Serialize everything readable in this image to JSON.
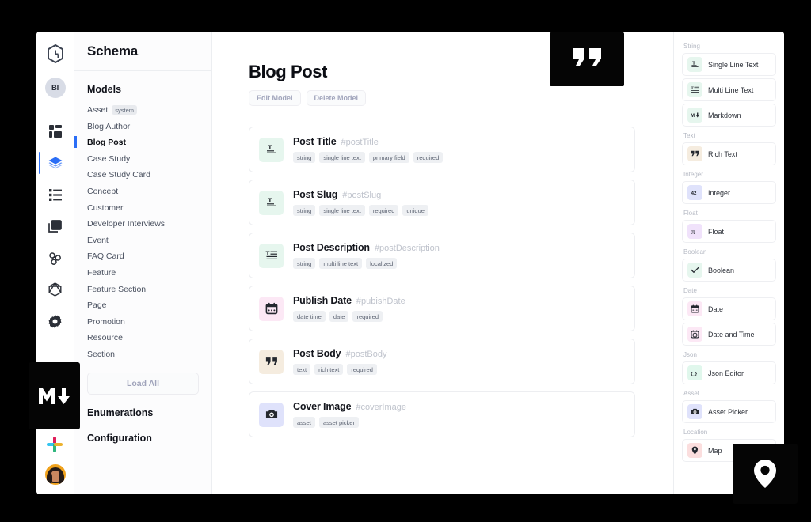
{
  "app": {
    "rail": {
      "logo_icon": "graphcms-logo-icon",
      "project_initials": "BI",
      "items": [
        {
          "icon": "dashboard-grid-icon",
          "name": "dashboard",
          "active": false
        },
        {
          "icon": "layers-schema-icon",
          "name": "schema",
          "active": true
        },
        {
          "icon": "content-list-icon",
          "name": "content",
          "active": false
        },
        {
          "icon": "assets-images-icon",
          "name": "assets",
          "active": false
        },
        {
          "icon": "webhooks-icon",
          "name": "webhooks",
          "active": false
        },
        {
          "icon": "graphql-playground-icon",
          "name": "api-playground",
          "active": false
        },
        {
          "icon": "gear-settings-icon",
          "name": "settings",
          "active": false
        }
      ],
      "bottom": [
        {
          "icon": "slack-icon",
          "name": "slack"
        },
        {
          "icon": "user-avatar",
          "name": "account"
        }
      ]
    },
    "sidebar": {
      "title": "Schema",
      "models_heading": "Models",
      "models": [
        {
          "label": "Asset",
          "badge": "system",
          "selected": false
        },
        {
          "label": "Blog Author",
          "badge": "",
          "selected": false
        },
        {
          "label": "Blog Post",
          "badge": "",
          "selected": true
        },
        {
          "label": "Case Study",
          "badge": "",
          "selected": false
        },
        {
          "label": "Case Study Card",
          "badge": "",
          "selected": false
        },
        {
          "label": "Concept",
          "badge": "",
          "selected": false
        },
        {
          "label": "Customer",
          "badge": "",
          "selected": false
        },
        {
          "label": "Developer Interviews",
          "badge": "",
          "selected": false
        },
        {
          "label": "Event",
          "badge": "",
          "selected": false
        },
        {
          "label": "FAQ Card",
          "badge": "",
          "selected": false
        },
        {
          "label": "Feature",
          "badge": "",
          "selected": false
        },
        {
          "label": "Feature Section",
          "badge": "",
          "selected": false
        },
        {
          "label": "Page",
          "badge": "",
          "selected": false
        },
        {
          "label": "Promotion",
          "badge": "",
          "selected": false
        },
        {
          "label": "Resource",
          "badge": "",
          "selected": false
        },
        {
          "label": "Section",
          "badge": "",
          "selected": false
        }
      ],
      "load_all_label": "Load All",
      "links": [
        {
          "label": "Enumerations"
        },
        {
          "label": "Configuration"
        }
      ]
    },
    "main": {
      "title": "Blog Post",
      "edit_model_label": "Edit Model",
      "delete_model_label": "Delete Model",
      "fields": [
        {
          "name": "Post Title",
          "api_id": "#postTitle",
          "icon": "single-line-text-icon",
          "icon_bg": "#e6f6ee",
          "chips": [
            "string",
            "single line text",
            "primary field",
            "required"
          ]
        },
        {
          "name": "Post Slug",
          "api_id": "#postSlug",
          "icon": "single-line-text-icon",
          "icon_bg": "#e6f6ee",
          "chips": [
            "string",
            "single line text",
            "required",
            "unique"
          ]
        },
        {
          "name": "Post Description",
          "api_id": "#postDescription",
          "icon": "multi-line-text-icon",
          "icon_bg": "#e6f6ee",
          "chips": [
            "string",
            "multi line text",
            "localized"
          ]
        },
        {
          "name": "Publish Date",
          "api_id": "#pubishDate",
          "icon": "calendar-icon",
          "icon_bg": "#fce8f5",
          "chips": [
            "date time",
            "date",
            "required"
          ]
        },
        {
          "name": "Post Body",
          "api_id": "#postBody",
          "icon": "quote-icon",
          "icon_bg": "#f5ecdf",
          "chips": [
            "text",
            "rich text",
            "required"
          ]
        },
        {
          "name": "Cover Image",
          "api_id": "#coverImage",
          "icon": "camera-icon",
          "icon_bg": "#dfe2fb",
          "chips": [
            "asset",
            "asset picker"
          ]
        }
      ]
    },
    "types_panel": {
      "groups": [
        {
          "label": "String",
          "items": [
            {
              "label": "Single Line Text",
              "icon": "single-line-text-icon",
              "icon_bg": "#e6f6ee"
            },
            {
              "label": "Multi Line Text",
              "icon": "multi-line-text-icon",
              "icon_bg": "#e6f6ee"
            },
            {
              "label": "Markdown",
              "icon": "markdown-icon",
              "icon_bg": "#e6f6ee"
            }
          ]
        },
        {
          "label": "Text",
          "items": [
            {
              "label": "Rich Text",
              "icon": "quote-icon",
              "icon_bg": "#f5ecdf"
            }
          ]
        },
        {
          "label": "Integer",
          "items": [
            {
              "label": "Integer",
              "icon": "number-42-icon",
              "icon_bg": "#dfe2fb"
            }
          ]
        },
        {
          "label": "Float",
          "items": [
            {
              "label": "Float",
              "icon": "pi-icon",
              "icon_bg": "#f0e2fb"
            }
          ]
        },
        {
          "label": "Boolean",
          "items": [
            {
              "label": "Boolean",
              "icon": "checkmark-icon",
              "icon_bg": "#e6f6ee"
            }
          ]
        },
        {
          "label": "Date",
          "items": [
            {
              "label": "Date",
              "icon": "calendar-icon",
              "icon_bg": "#fce8f5"
            },
            {
              "label": "Date and Time",
              "icon": "clock-calendar-icon",
              "icon_bg": "#fce8f5"
            }
          ]
        },
        {
          "label": "Json",
          "items": [
            {
              "label": "Json Editor",
              "icon": "braces-icon",
              "icon_bg": "#e0f7ec"
            }
          ]
        },
        {
          "label": "Asset",
          "items": [
            {
              "label": "Asset Picker",
              "icon": "camera-icon",
              "icon_bg": "#dfe2fb"
            }
          ]
        },
        {
          "label": "Location",
          "items": [
            {
              "label": "Map",
              "icon": "map-pin-icon",
              "icon_bg": "#fbdede"
            }
          ]
        }
      ]
    },
    "overlays": [
      {
        "name": "quote-tile",
        "icon": "quote-icon"
      },
      {
        "name": "markdown-tile",
        "icon": "markdown-icon"
      },
      {
        "name": "map-pin-tile",
        "icon": "map-pin-icon"
      }
    ],
    "colors": {
      "accent": "#2b6ef6",
      "text_primary": "#0b0d13",
      "text_muted": "#a0a4bb",
      "chip_bg": "#eef0f3",
      "overlay_bg": "#050505"
    }
  }
}
